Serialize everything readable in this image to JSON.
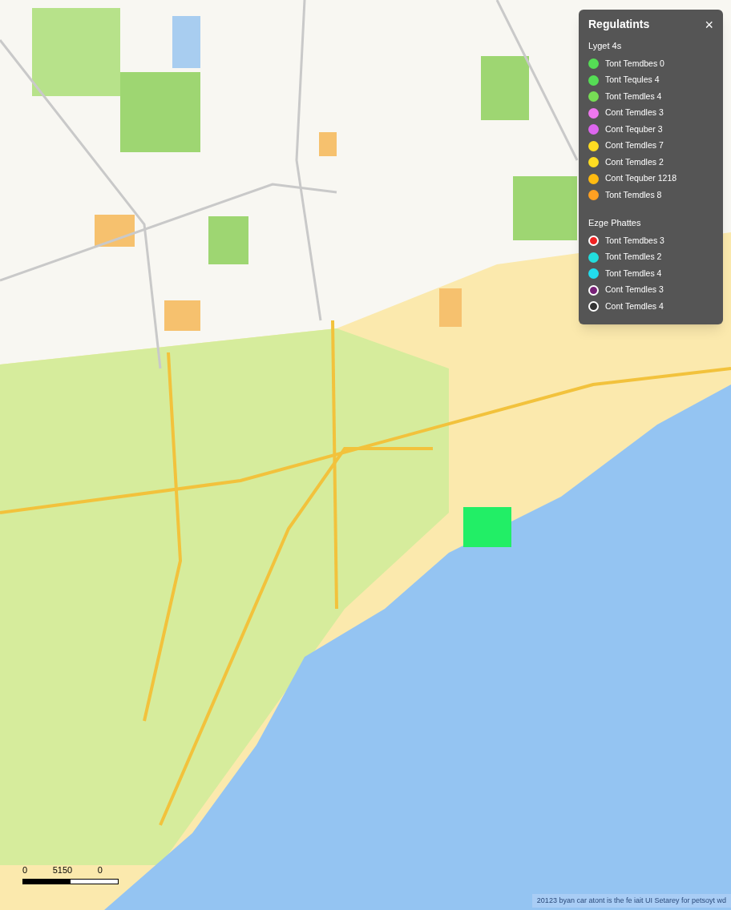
{
  "legend": {
    "title": "Regulatints",
    "close": "×",
    "sections": [
      {
        "heading": "Lyget 4s",
        "items": [
          {
            "label": "Tont Temdbes 0",
            "color": "#55dd55",
            "kind": "dot"
          },
          {
            "label": "Tont Tequles 4",
            "color": "#55dd55",
            "kind": "dot"
          },
          {
            "label": "Tont Temdles 4",
            "color": "#77dd55",
            "kind": "dot"
          },
          {
            "label": "Cont Temdles 3",
            "color": "#ee77ee",
            "kind": "dot"
          },
          {
            "label": "Cont Tequber 3",
            "color": "#dd66ee",
            "kind": "dot"
          },
          {
            "label": "Cont Temdles 7",
            "color": "#ffdd22",
            "kind": "dot"
          },
          {
            "label": "Cont Temdles 2",
            "color": "#ffdd22",
            "kind": "dot"
          },
          {
            "label": "Cont Tequber 1218",
            "color": "#ffbb11",
            "kind": "dot"
          },
          {
            "label": "Tont Temdles 8",
            "color": "#ffa022",
            "kind": "dot"
          }
        ]
      },
      {
        "heading": "Ezge Phattes",
        "items": [
          {
            "label": "Tont Temdbes 3",
            "color": "#ee2222",
            "kind": "ring"
          },
          {
            "label": "Tont Temdles 2",
            "color": "#22dddd",
            "kind": "dot"
          },
          {
            "label": "Tont Temdles 4",
            "color": "#22ddee",
            "kind": "dot"
          },
          {
            "label": "Cont Temdles 3",
            "color": "#772277",
            "kind": "ring"
          },
          {
            "label": "Cont Temdles 4",
            "color": "#333333",
            "kind": "ring"
          }
        ]
      }
    ]
  },
  "scale_bar": {
    "labels": [
      "0",
      "5150",
      "0"
    ]
  },
  "attribution": "20123 byan car atont is the fe iait UI Setarey for petsoyt wd"
}
